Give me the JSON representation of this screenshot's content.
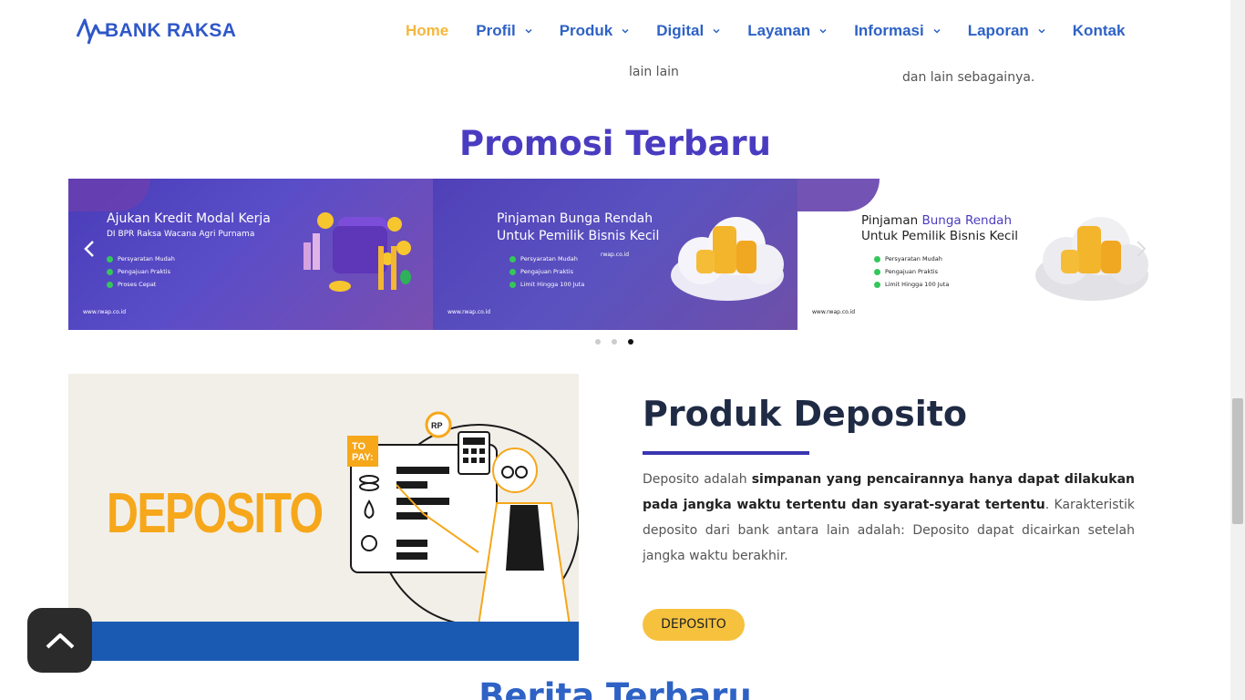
{
  "header": {
    "logo_text": "BANK RAKSA",
    "nav": [
      {
        "label": "Home",
        "dropdown": false,
        "active": true
      },
      {
        "label": "Profil",
        "dropdown": true
      },
      {
        "label": "Produk",
        "dropdown": true
      },
      {
        "label": "Digital",
        "dropdown": true
      },
      {
        "label": "Layanan",
        "dropdown": true
      },
      {
        "label": "Informasi",
        "dropdown": true
      },
      {
        "label": "Laporan",
        "dropdown": true
      },
      {
        "label": "Kontak",
        "dropdown": false
      }
    ]
  },
  "previous_section": {
    "text_a": "lain lain",
    "text_b": "dan lain sebagainya."
  },
  "promo": {
    "title": "Promosi Terbaru",
    "slides": [
      {
        "heading": "Ajukan Kredit Modal Kerja",
        "subheading": "DI BPR Raksa Wacana Agri Purnama",
        "bullets": [
          "Persyaratan Mudah",
          "Pengajuan Praktis",
          "Proses Cepat"
        ],
        "url": "www.rwap.co.id"
      },
      {
        "heading": "Pinjaman Bunga Rendah",
        "subheading": "Untuk Pemilik Bisnis Kecil",
        "bullets": [
          "Persyaratan Mudah",
          "Pengajuan Praktis",
          "Limit Hingga 100 Juta"
        ],
        "url": "www.rwap.co.id",
        "url2": "rwap.co.id"
      },
      {
        "heading_a": "Pinjaman",
        "heading_b": "Bunga Rendah",
        "subheading": "Untuk Pemilik Bisnis Kecil",
        "bullets": [
          "Persyaratan Mudah",
          "Pengajuan Praktis",
          "Limit Hingga 100 Juta"
        ],
        "url": "www.rwap.co.id"
      }
    ],
    "prev_arrow": "‹",
    "next_arrow": "›",
    "dots_count": 3,
    "active_dot": 3
  },
  "deposito": {
    "image_word": "DEPOSITO",
    "image_tag": "TO PAY:",
    "image_coin": "RP",
    "title": "Produk Deposito",
    "desc_1": "Deposito adalah ",
    "desc_bold": "simpanan yang pencairannya hanya dapat dilakukan pada jangka waktu tertentu dan syarat-syarat tertentu",
    "desc_2": ". Karakteristik deposito dari bank antara lain adalah: Deposito dapat dicairkan setelah jangka waktu berakhir.",
    "button": "DEPOSITO"
  },
  "berita": {
    "title": "Berita Terbaru"
  },
  "colors": {
    "nav": "#2e62c5",
    "nav_active": "#f6b73c",
    "promo_title": "#4a3cc0",
    "button": "#f6c23e",
    "deposit_bar": "#1b5ab3"
  }
}
